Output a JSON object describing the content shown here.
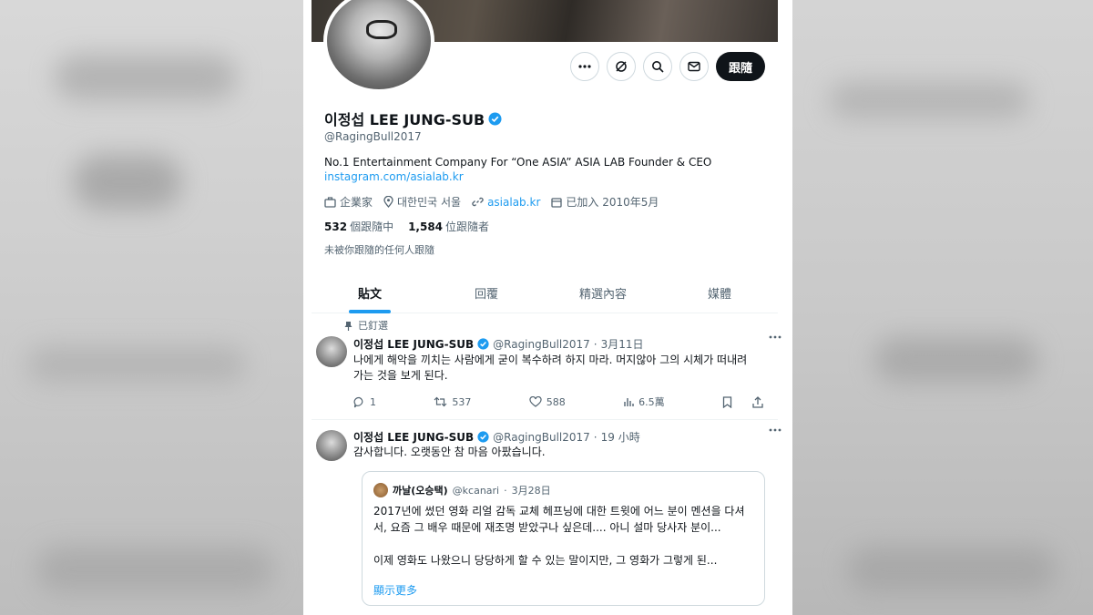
{
  "profile": {
    "display_name": "이정섭 LEE JUNG-SUB",
    "handle": "@RagingBull2017",
    "bio_line": "No.1 Entertainment Company For “One ASIA”  ASIA LAB Founder & CEO",
    "bio_link": "instagram.com/asialab.kr",
    "category": "企業家",
    "location": "대한민국 서울",
    "website": "asialab.kr",
    "joined": "已加入 2010年5月",
    "following_count": "532",
    "following_label": "個跟隨中",
    "followers_count": "1,584",
    "followers_label": "位跟隨者",
    "not_followed_note": "未被你跟隨的任何人跟隨",
    "follow_button": "跟隨"
  },
  "tabs": [
    "貼文",
    "回覆",
    "精選內容",
    "媒體"
  ],
  "tweets": [
    {
      "pinned_label": "已釘選",
      "name": "이정섭 LEE JUNG-SUB",
      "handle": "@RagingBull2017",
      "time": "3月11日",
      "text": "나에게 해악을 끼치는 사람에게 굳이 복수하려 하지 마라. 머지않아 그의 시체가 떠내려가는 것을 보게 된다.",
      "replies": "1",
      "retweets": "537",
      "likes": "588",
      "views": "6.5萬"
    },
    {
      "name": "이정섭 LEE JUNG-SUB",
      "handle": "@RagingBull2017",
      "time": "19 小時",
      "text": "감사합니다. 오랫동안 참 마음 아팠습니다.",
      "quote": {
        "name": "까날(오승택)",
        "handle": "@kcanari",
        "time": "3月28日",
        "text1": "2017년에 썼던 영화 리얼 감독 교체 헤프닝에 대한 트윗에 어느 분이 멘션을 다셔서, 요즘 그 배우 때문에 재조명 받았구나 싶은데.... 아니 설마 당사자 분이...",
        "text2": "이제 영화도 나왔으니 당당하게 할 수 있는 말이지만, 그 영화가 그렇게 된...",
        "show_more": "顯示更多"
      }
    }
  ],
  "colors": {
    "accent": "#1d9bf0",
    "text": "#0f1419",
    "muted": "#536471"
  },
  "icons": [
    "more-icon",
    "grok-icon",
    "search-icon",
    "mail-icon",
    "verified-icon",
    "briefcase-icon",
    "location-icon",
    "link-icon",
    "calendar-icon",
    "pin-icon",
    "reply-icon",
    "retweet-icon",
    "like-icon",
    "views-icon",
    "bookmark-icon",
    "share-icon"
  ]
}
